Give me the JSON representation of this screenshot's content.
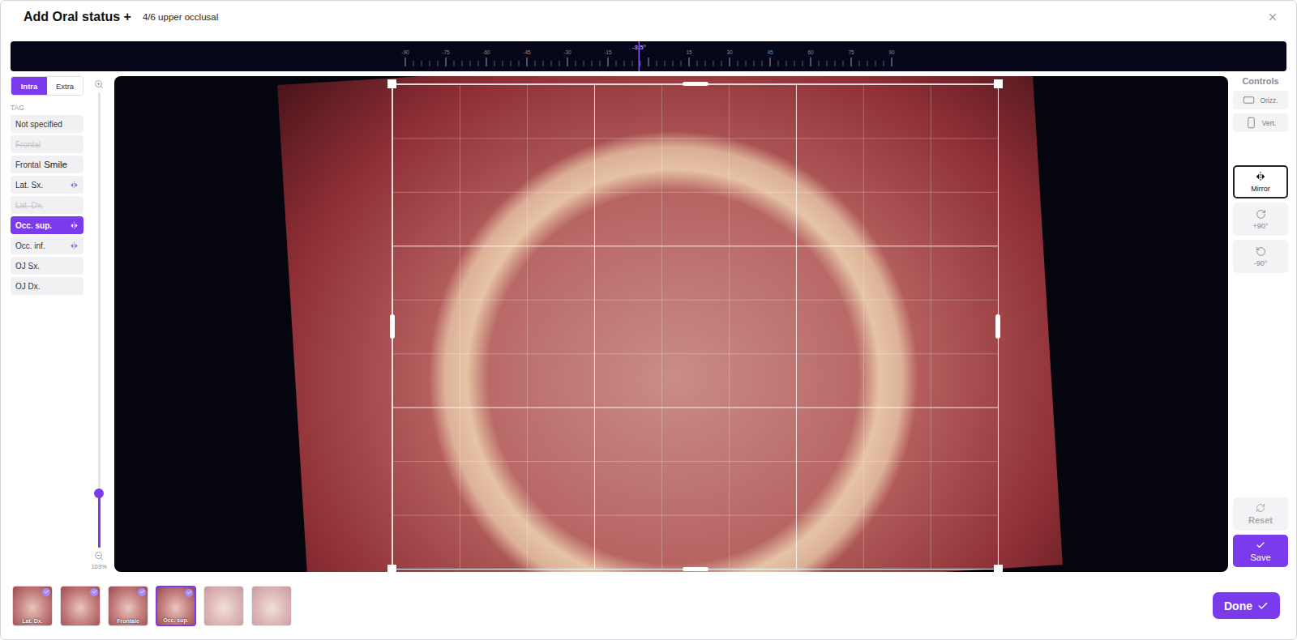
{
  "header": {
    "title": "Add Oral status +",
    "subtitle": "4/6 upper occlusal"
  },
  "ruler": {
    "labels": [
      "-90",
      "-75",
      "-60",
      "-45",
      "-30",
      "-15",
      "15",
      "30",
      "45",
      "60",
      "75",
      "90"
    ],
    "reading": "-3.5°",
    "level": 0.4806
  },
  "mode_toggle": [
    {
      "label": "Intra",
      "selected": true
    },
    {
      "label": "Extra",
      "selected": false
    }
  ],
  "tag_section": {
    "title": "TAG"
  },
  "tags": [
    {
      "label": "Not specified",
      "kind": "plain",
      "disabled": false,
      "selected": false
    },
    {
      "label": "Frontal",
      "kind": "plain",
      "disabled": true,
      "selected": false
    },
    {
      "label": "Frontal",
      "suffix": "Smile",
      "kind": "plain",
      "disabled": false,
      "selected": false
    },
    {
      "label": "Lat. Sx.",
      "kind": "mirrorable",
      "disabled": false,
      "selected": false
    },
    {
      "label": "Lat. Dx.",
      "kind": "plain",
      "disabled": true,
      "selected": false
    },
    {
      "label": "Occ. sup.",
      "kind": "mirrorable",
      "disabled": false,
      "selected": true
    },
    {
      "label": "Occ. inf.",
      "kind": "mirrorable",
      "disabled": false,
      "selected": false
    },
    {
      "label": "OJ Sx.",
      "kind": "plain",
      "disabled": false,
      "selected": false
    },
    {
      "label": "OJ Dx.",
      "kind": "plain",
      "disabled": false,
      "selected": false
    }
  ],
  "zoom": {
    "level": 0.12,
    "reading": "103%"
  },
  "controls": {
    "title": "Controls",
    "orientation": [
      {
        "label": "Orizz.",
        "kind": "horizontal",
        "selected": false
      },
      {
        "label": "Vert.",
        "kind": "vertical",
        "selected": false
      }
    ],
    "transforms": [
      {
        "label": "Mirror",
        "kind": "mirror",
        "selected": true
      },
      {
        "label": "+90°",
        "kind": "rotate-cw",
        "selected": false
      },
      {
        "label": "-90°",
        "kind": "rotate-ccw",
        "selected": false
      }
    ],
    "reset": {
      "label": "Reset",
      "disabled": true
    },
    "save": {
      "label": "Save"
    }
  },
  "thumbnails": [
    {
      "label": "Lat. Dx.",
      "checked": true,
      "selected": false
    },
    {
      "checked": true,
      "selected": false
    },
    {
      "label": "Frontale",
      "checked": true,
      "selected": false
    },
    {
      "label": "Occ. sup.",
      "checked": true,
      "selected": true
    },
    {
      "checked": false,
      "selected": false
    },
    {
      "checked": false,
      "selected": false
    }
  ],
  "done": {
    "label": "Done"
  }
}
